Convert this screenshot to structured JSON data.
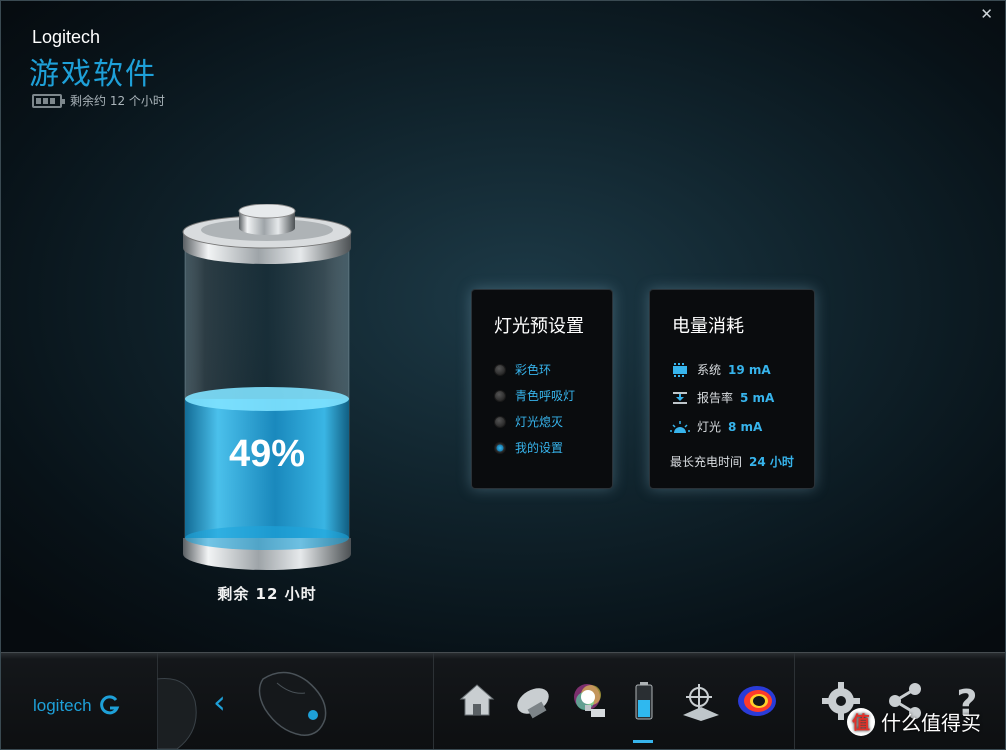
{
  "window": {
    "close_label": "✕"
  },
  "header": {
    "brand": "Logitech",
    "title": "游戏软件",
    "battery_status": "剩余约 12 个小时"
  },
  "battery": {
    "percent_label": "49%",
    "level": 0.49,
    "remaining": "剩余 12 小时",
    "fill_color": "#2fb8ef"
  },
  "lighting_panel": {
    "title": "灯光预设置",
    "options": [
      {
        "label": "彩色环",
        "selected": false
      },
      {
        "label": "青色呼吸灯",
        "selected": false
      },
      {
        "label": "灯光熄灭",
        "selected": false
      },
      {
        "label": "我的设置",
        "selected": true
      }
    ]
  },
  "power_panel": {
    "title": "电量消耗",
    "rows": [
      {
        "label": "系统",
        "value": "19 mA",
        "icon": "chip-icon"
      },
      {
        "label": "报告率",
        "value": "5 mA",
        "icon": "report-rate-icon"
      },
      {
        "label": "灯光",
        "value": "8 mA",
        "icon": "light-icon"
      }
    ],
    "max_charge_label": "最长充电时间",
    "max_charge_value": "24 小时"
  },
  "bottom_bar": {
    "logo": "logitech",
    "icons": [
      "home-icon",
      "mouse-buttons-icon",
      "lighting-icon",
      "battery-icon",
      "dpi-icon",
      "heatmap-icon",
      "gear-icon",
      "share-icon",
      "help-icon"
    ],
    "active": "battery-icon"
  },
  "watermark": {
    "text": "什么值得买",
    "logo": "值"
  },
  "colors": {
    "accent": "#1ea0d8",
    "highlight": "#37b4ec"
  }
}
